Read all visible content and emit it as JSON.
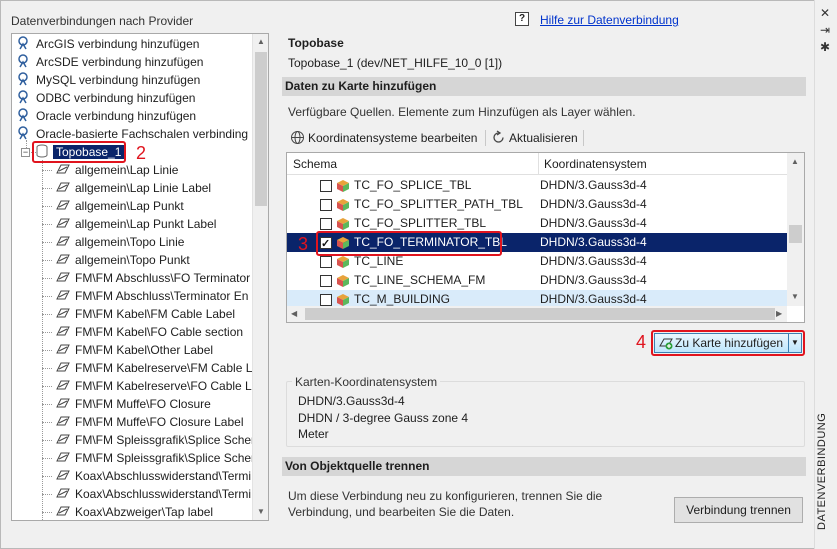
{
  "left_panel": {
    "title": "Datenverbindungen nach Provider",
    "providers": [
      {
        "label": "ArcGIS verbindung hinzufügen"
      },
      {
        "label": "ArcSDE verbindung hinzufügen"
      },
      {
        "label": "MySQL verbindung hinzufügen"
      },
      {
        "label": "ODBC verbindung hinzufügen"
      },
      {
        "label": "Oracle verbindung hinzufügen"
      },
      {
        "label": "Oracle-basierte Fachschalen verbinding"
      }
    ],
    "connection_node": {
      "label": "Topobase_1"
    },
    "layers": [
      "allgemein\\Lap Linie",
      "allgemein\\Lap Linie Label",
      "allgemein\\Lap Punkt",
      "allgemein\\Lap Punkt Label",
      "allgemein\\Topo Linie",
      "allgemein\\Topo Punkt",
      "FM\\FM Abschluss\\FO Terminator",
      "FM\\FM Abschluss\\Terminator En",
      "FM\\FM Kabel\\FM Cable Label",
      "FM\\FM Kabel\\FO Cable section",
      "FM\\FM Kabel\\Other Label",
      "FM\\FM Kabelreserve\\FM Cable Lo",
      "FM\\FM Kabelreserve\\FO Cable Lo",
      "FM\\FM Muffe\\FO Closure",
      "FM\\FM Muffe\\FO Closure Label",
      "FM\\FM Spleissgrafik\\Splice Scher",
      "FM\\FM Spleissgrafik\\Splice Scher",
      "Koax\\Abschlusswiderstand\\Termi",
      "Koax\\Abschlusswiderstand\\Termi",
      "Koax\\Abzweiger\\Tap label"
    ]
  },
  "help": {
    "icon": "?",
    "link": "Hilfe zur Datenverbindung"
  },
  "connection": {
    "title": "Topobase",
    "detail": "Topobase_1 (dev/NET_HILFE_10_0 [1])"
  },
  "add_section": {
    "header": "Daten zu Karte hinzufügen",
    "description": "Verfügbare Quellen. Elemente zum Hinzufügen als Layer wählen.",
    "toolbar": {
      "edit_cs_label": "Koordinatensysteme bearbeiten",
      "refresh_label": "Aktualisieren"
    },
    "grid": {
      "col_schema": "Schema",
      "col_cs": "Koordinatensystem",
      "rows": [
        {
          "name": "TC_FO_SPLICE_TBL",
          "cs": "DHDN/3.Gauss3d-4",
          "checked": false,
          "state": "normal"
        },
        {
          "name": "TC_FO_SPLITTER_PATH_TBL",
          "cs": "DHDN/3.Gauss3d-4",
          "checked": false,
          "state": "normal"
        },
        {
          "name": "TC_FO_SPLITTER_TBL",
          "cs": "DHDN/3.Gauss3d-4",
          "checked": false,
          "state": "normal"
        },
        {
          "name": "TC_FO_TERMINATOR_TBL",
          "cs": "DHDN/3.Gauss3d-4",
          "checked": true,
          "state": "selected"
        },
        {
          "name": "TC_LINE",
          "cs": "DHDN/3.Gauss3d-4",
          "checked": false,
          "state": "normal"
        },
        {
          "name": "TC_LINE_SCHEMA_FM",
          "cs": "DHDN/3.Gauss3d-4",
          "checked": false,
          "state": "normal"
        },
        {
          "name": "TC_M_BUILDING",
          "cs": "DHDN/3.Gauss3d-4",
          "checked": false,
          "state": "hover"
        }
      ]
    },
    "add_button": "Zu Karte hinzufügen"
  },
  "coord_system": {
    "legend": "Karten-Koordinatensystem",
    "line1": "DHDN/3.Gauss3d-4",
    "line2": "DHDN / 3-degree Gauss zone 4",
    "line3": "Meter"
  },
  "disconnect_section": {
    "header": "Von Objektquelle trennen",
    "text": "Um diese Verbindung neu zu konfigurieren, trennen Sie die Verbindung, und bearbeiten Sie die Daten.",
    "button": "Verbindung trennen"
  },
  "annotations": [
    "2",
    "3",
    "4"
  ],
  "palette": {
    "side_label": "DATENVERBINDUNG"
  },
  "colors": {
    "selected_row": "#0a246a",
    "annotation_red": "#e0141e",
    "link": "#0033cc"
  }
}
